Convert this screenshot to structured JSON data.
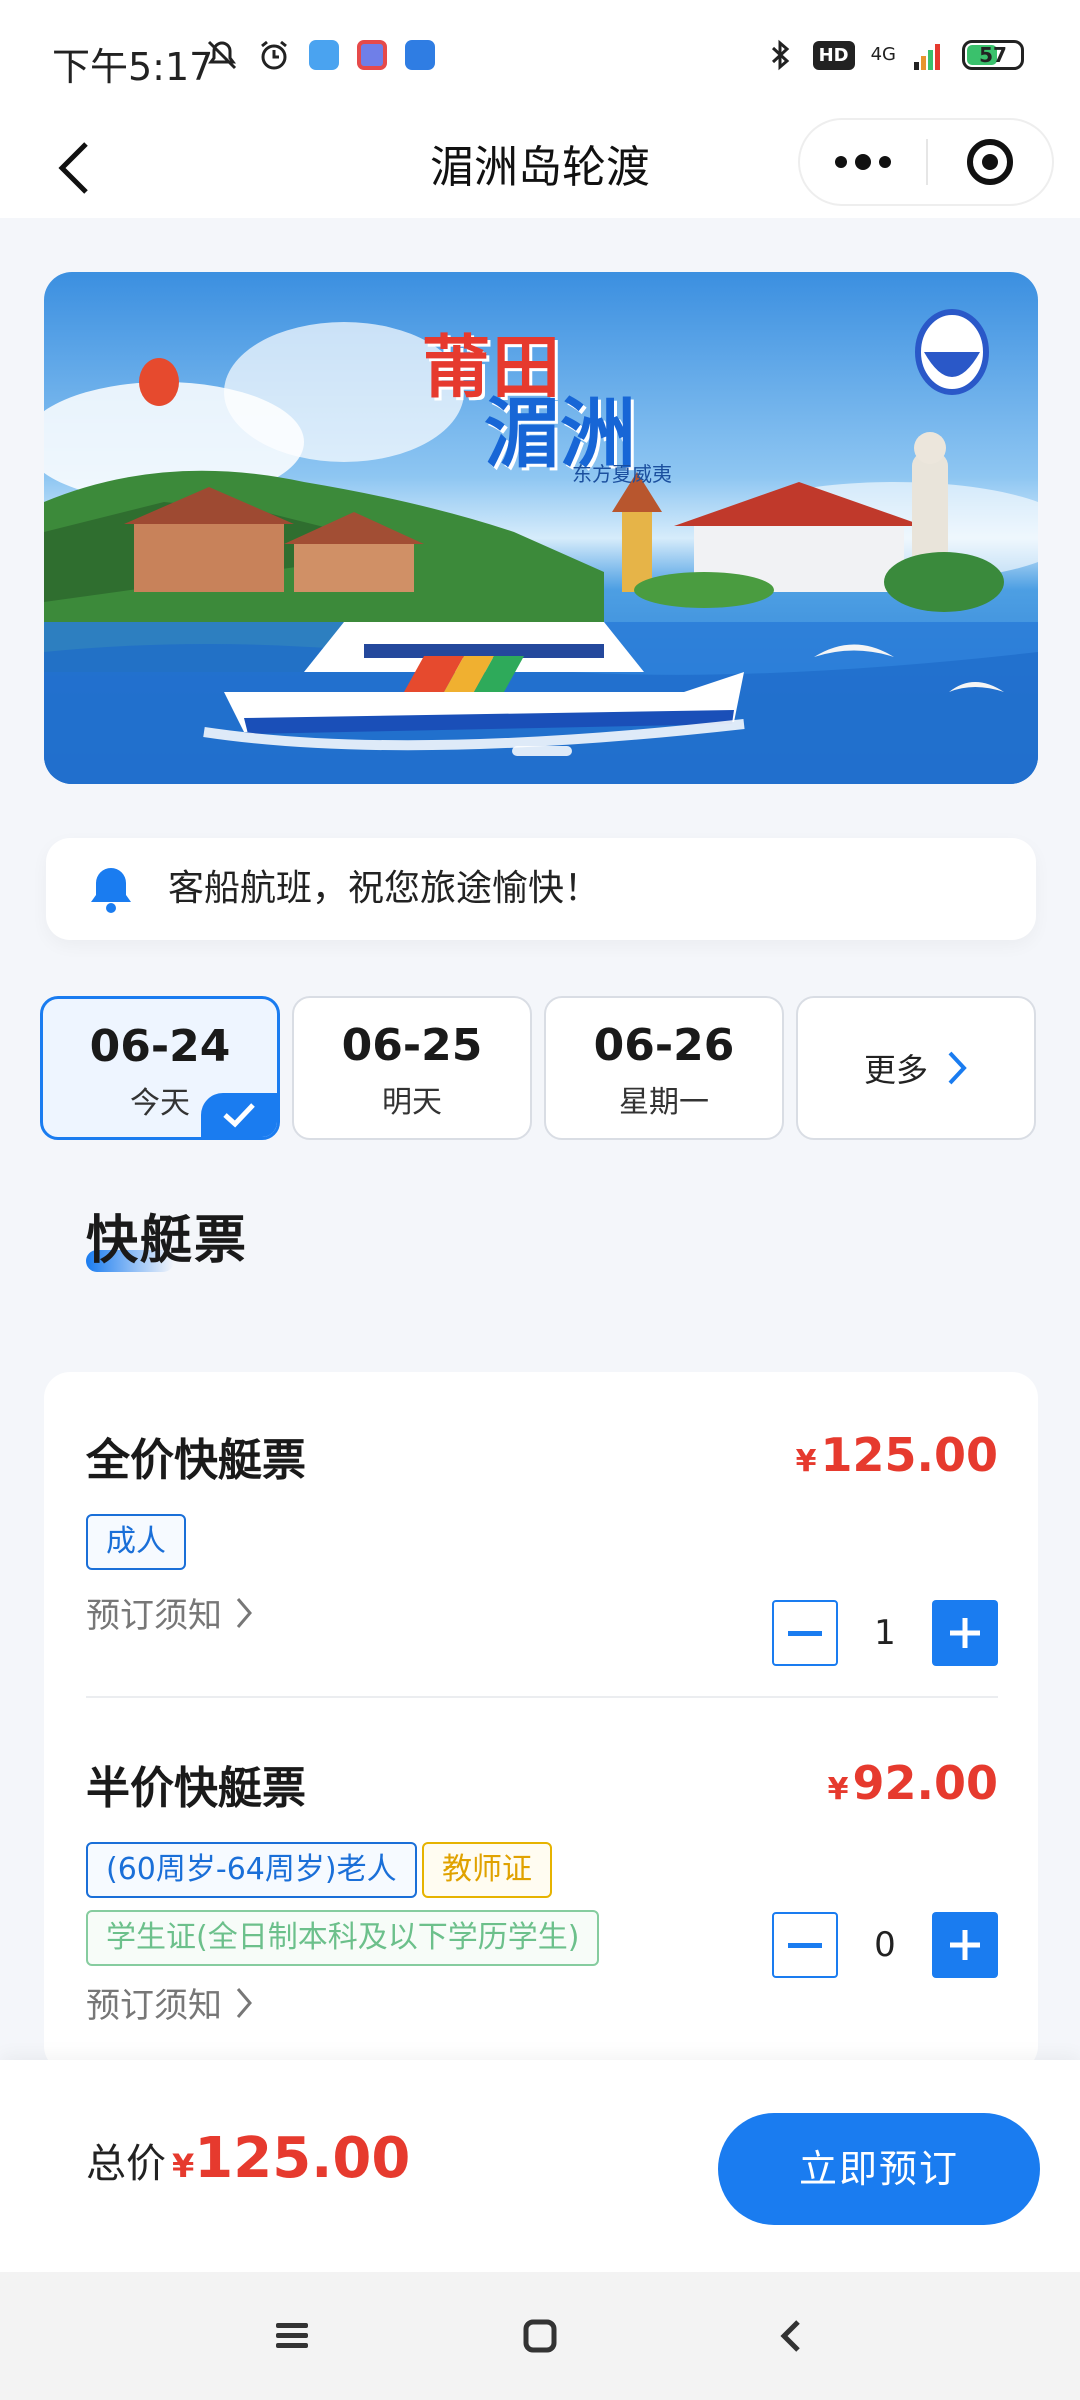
{
  "status_bar": {
    "time": "下午5:17",
    "network": "4G",
    "hd": "HD",
    "battery": "57"
  },
  "nav": {
    "title": "湄洲岛轮渡"
  },
  "banner": {
    "title_line1": "莆田",
    "title_line2": "湄洲",
    "subtitle": "东方夏威夷"
  },
  "notice": {
    "text": "客船航班，祝您旅途愉快！"
  },
  "dates": [
    {
      "date": "06-24",
      "weekday": "今天",
      "selected": true
    },
    {
      "date": "06-25",
      "weekday": "明天",
      "selected": false
    },
    {
      "date": "06-26",
      "weekday": "星期一",
      "selected": false
    }
  ],
  "dates_more_label": "更多",
  "section": {
    "title": "快艇票"
  },
  "tickets": [
    {
      "name": "全价快艇票",
      "currency": "¥",
      "price": "125.00",
      "tags": [
        "成人"
      ],
      "notice_link": "预订须知",
      "quantity": "1"
    },
    {
      "name": "半价快艇票",
      "currency": "¥",
      "price": "92.00",
      "tags": [
        "(60周岁-64周岁)老人",
        "教师证",
        "学生证(全日制本科及以下学历学生)"
      ],
      "notice_link": "预订须知",
      "quantity": "0"
    }
  ],
  "footer": {
    "total_label": "总价",
    "currency": "¥",
    "total_amount": "125.00",
    "book_button": "立即预订"
  },
  "colors": {
    "accent": "#1a7cf0",
    "price": "#e63a2e",
    "tag_blue": "#1a6fd8",
    "tag_yellow": "#e6b300",
    "tag_green": "#86cc9f"
  }
}
